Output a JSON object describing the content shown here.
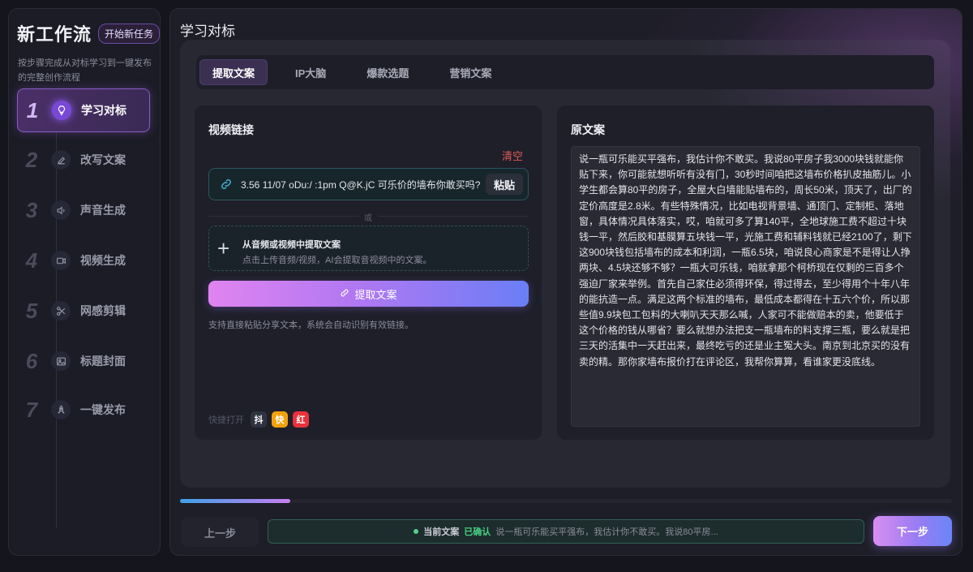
{
  "sidebar": {
    "title": "新工作流",
    "new_task_label": "开始新任务",
    "description": "按步骤完成从对标学习到一键发布的完整创作流程",
    "steps": [
      {
        "num": "1",
        "label": "学习对标",
        "icon": "lightbulb-icon"
      },
      {
        "num": "2",
        "label": "改写文案",
        "icon": "pen-icon"
      },
      {
        "num": "3",
        "label": "声音生成",
        "icon": "speaker-icon"
      },
      {
        "num": "4",
        "label": "视频生成",
        "icon": "video-camera-icon"
      },
      {
        "num": "5",
        "label": "网感剪辑",
        "icon": "scissors-icon"
      },
      {
        "num": "6",
        "label": "标题封面",
        "icon": "image-icon"
      },
      {
        "num": "7",
        "label": "一键发布",
        "icon": "rocket-icon"
      }
    ]
  },
  "main": {
    "title": "学习对标",
    "tabs": [
      {
        "label": "提取文案",
        "active": true
      },
      {
        "label": "IP大脑",
        "active": false
      },
      {
        "label": "爆款选题",
        "active": false
      },
      {
        "label": "营销文案",
        "active": false
      }
    ],
    "video_link": {
      "title": "视频链接",
      "clear_label": "清空",
      "link_value": "3.56 11/07 oDu:/ :1pm Q@K.jC 可乐价的墙布你敢买吗?",
      "paste_label": "粘贴",
      "or_label": "或",
      "upload_title": "从音频或视频中提取文案",
      "upload_desc": "点击上传音频/视频，AI会提取音视频中的文案。",
      "extract_label": "提取文案",
      "hint": "支持直接粘贴分享文本，系统会自动识别有效链接。",
      "quick_label": "快捷打开",
      "quick_apps": [
        {
          "label": "抖",
          "color": "#2f3340"
        },
        {
          "label": "快",
          "color": "#f2a20c"
        },
        {
          "label": "红",
          "color": "#e8323c"
        }
      ]
    },
    "original": {
      "title": "原文案",
      "text": "说一瓶可乐能买平强布，我估计你不敢买。我说80平房子我3000块钱就能你贴下来，你可能就想听听有没有门，30秒时间咱把这墙布价格扒皮抽筋儿。小学生都会算80平的房子，全屋大白墙能贴墙布的，周长50米，顶天了，出厂的定价高度是2.8米。有些特殊情况，比如电视背景墙、通顶门、定制柜、落地窗，具体情况具体落实，哎，咱就可多了算140平，全地球施工费不超过十块钱一平，然后胶和基膜算五块钱一平，光施工费和辅料钱就已经2100了，剩下这900块钱包括墙布的成本和利润，一瓶6.5块，咱说良心商家是不是得让人挣两块、4.5块还够不够？一瓶大可乐钱，咱就拿那个柯桥现在仅剩的三百多个强迫厂家来举例。首先自己家住必须得环保，得过得去，至少得用个十年八年的能抗造一点。满足这两个标准的墙布，最低成本都得在十五六个价，所以那些值9.9块包工包料的大喇叭天天那么喊，人家可不能做赔本的卖，他要低于这个价格的钱从哪省？要么就想办法把支一瓶墙布的料支撑三瓶，要么就是把三天的活集中一天赶出来，最终吃亏的还是业主冤大头。南京到北京买的没有卖的精。那你家墙布报价打在评论区，我帮你算算，看谁家更没底线。"
    }
  },
  "footer": {
    "progress": 0.143,
    "prev_label": "上一步",
    "status_label": "当前文案",
    "status_ok": "已确认",
    "status_text": "说一瓶可乐能买平强布，我估计你不敢买。我说80平房...",
    "next_label": "下一步"
  }
}
